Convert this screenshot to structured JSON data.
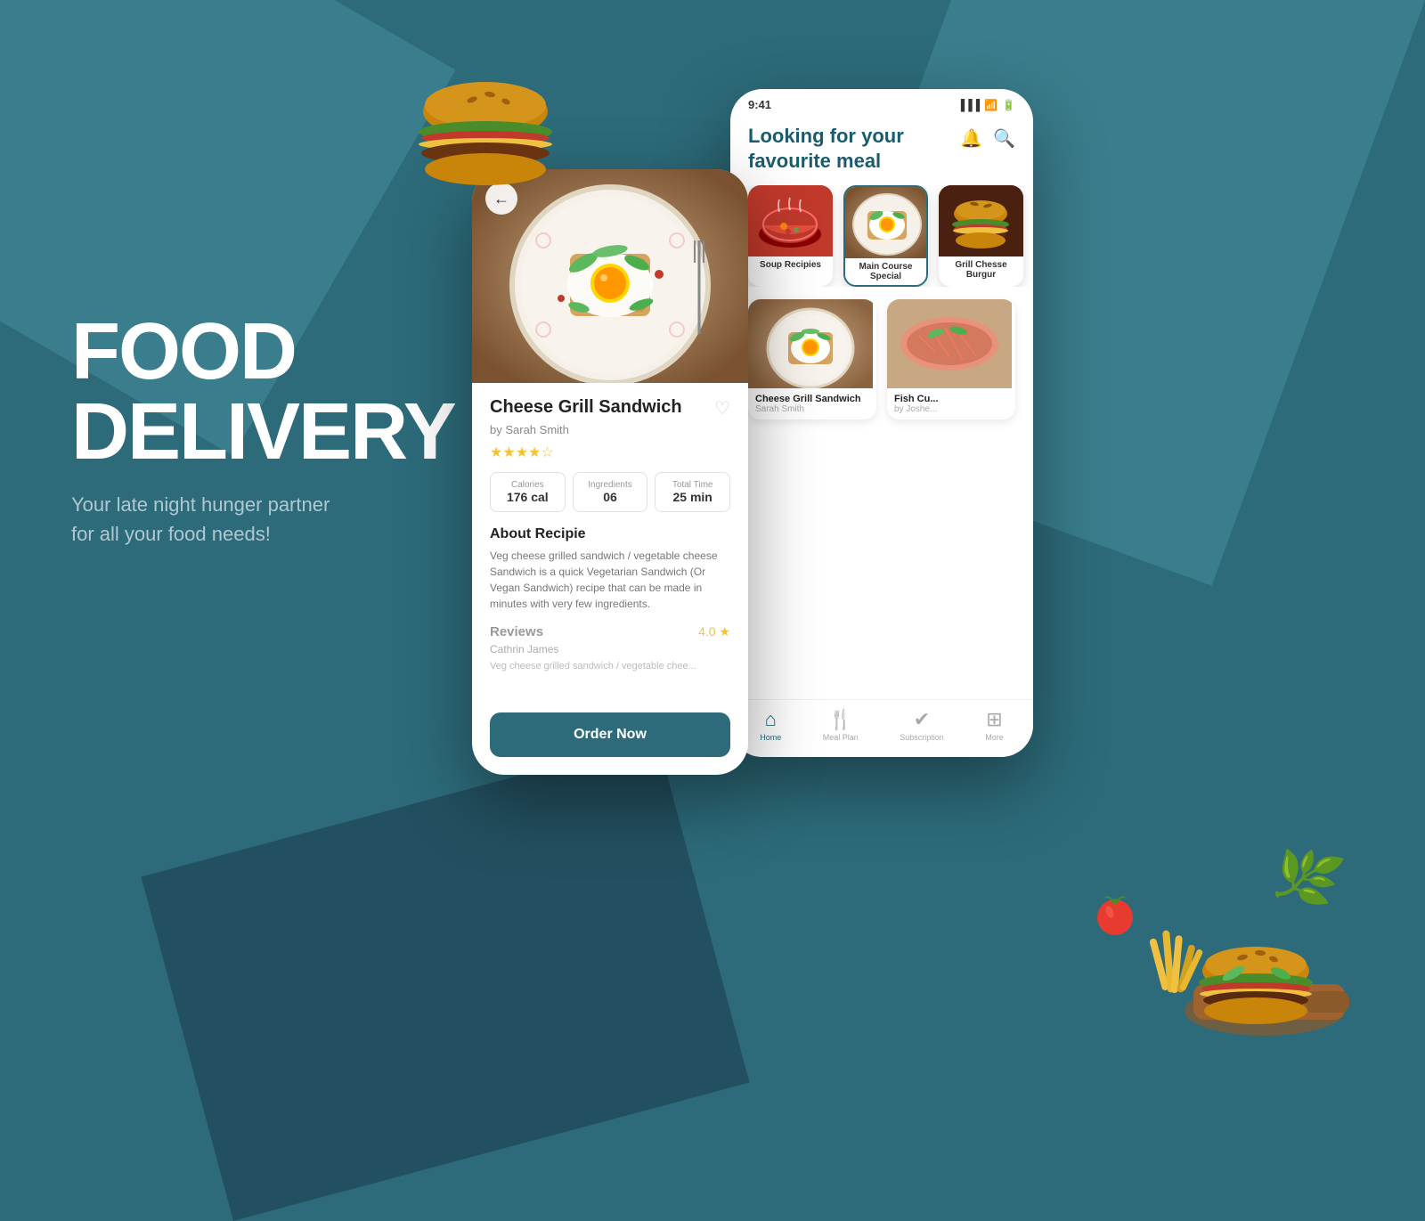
{
  "background": {
    "color": "#2d6b7a"
  },
  "hero": {
    "title_line1": "FOOD",
    "title_line2": "DELIVERY",
    "subtitle": "Your late night hunger partner",
    "subtitle2": "for all your food needs!"
  },
  "detail_phone": {
    "food_name": "Cheese Grill Sandwich",
    "food_author": "by Sarah Smith",
    "stars": "★★★★☆",
    "heart": "♡",
    "stats": [
      {
        "label": "Calories",
        "value": "176 cal"
      },
      {
        "label": "Ingredients",
        "value": "06"
      },
      {
        "label": "Total Time",
        "value": "25 min"
      }
    ],
    "about_title": "About Recipie",
    "about_text": "Veg cheese grilled sandwich / vegetable cheese Sandwich is a quick Vegetarian Sandwich (Or Vegan Sandwich) recipe that can be made in minutes with very few ingredients.",
    "reviews_title": "Reviews",
    "reviews_score": "4.0 ★",
    "reviewer_name": "Cathrin James",
    "review_preview": "Veg cheese grilled sandwich / vegetable chee...",
    "order_btn_label": "Order Now",
    "back_arrow": "←"
  },
  "home_phone": {
    "status_time": "9:41",
    "status_signal": "▐▐▐",
    "status_wifi": "▲",
    "status_battery": "▮▮▮",
    "header_title": "Looking for your favourite meal",
    "categories": [
      {
        "label": "Soup Recipies",
        "emoji": "🍲",
        "type": "soup"
      },
      {
        "label": "Main Course Special",
        "emoji": "🍳",
        "type": "sandwich"
      },
      {
        "label": "Grill Chesse Burgur",
        "emoji": "🍔",
        "type": "burger"
      }
    ],
    "food_items": [
      {
        "name": "Cheese Grill Sandwich",
        "author": "Sarah Smith",
        "type": "fried"
      },
      {
        "name": "Fish Cu...",
        "author": "by Joshe...",
        "type": "salmon"
      }
    ],
    "nav_items": [
      {
        "label": "Home",
        "icon": "⌂",
        "active": true
      },
      {
        "label": "Meal Plan",
        "icon": "🍴",
        "active": false
      },
      {
        "label": "Subscription",
        "icon": "✓",
        "active": false
      },
      {
        "label": "More",
        "icon": "⊞",
        "active": false
      }
    ]
  }
}
